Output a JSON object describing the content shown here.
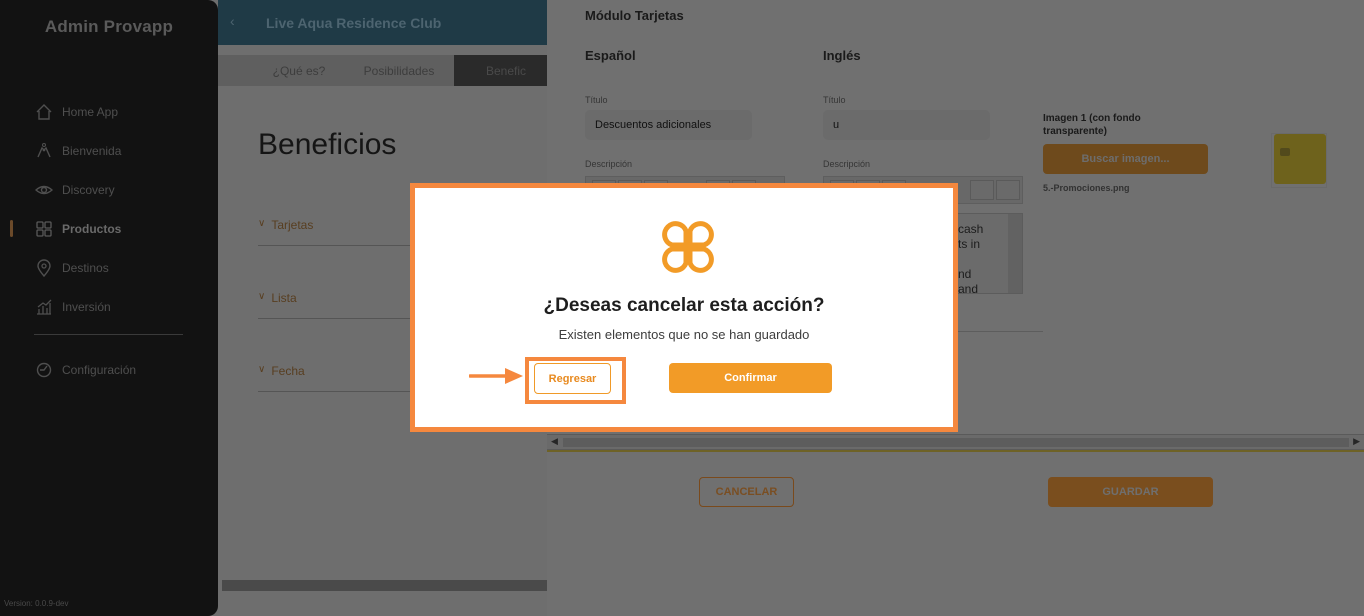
{
  "sidebar": {
    "brand": "Admin Provapp",
    "items": [
      {
        "label": "Home App",
        "icon": "home-icon"
      },
      {
        "label": "Bienvenida",
        "icon": "hands-icon"
      },
      {
        "label": "Discovery",
        "icon": "eye-icon"
      },
      {
        "label": "Productos",
        "icon": "grid-icon",
        "active": true
      },
      {
        "label": "Destinos",
        "icon": "pin-icon"
      },
      {
        "label": "Inversión",
        "icon": "chart-icon"
      }
    ],
    "config": {
      "label": "Configuración",
      "icon": "gear-icon"
    },
    "version": "Version: 0.0.9-dev"
  },
  "page": {
    "topbar_title": "Live Aqua Residence Club",
    "tabs": [
      "¿Qué es?",
      "Posibilidades",
      "Benefic"
    ],
    "title": "Beneficios",
    "accordions": [
      "Tarjetas",
      "Lista",
      "Fecha"
    ]
  },
  "drawer": {
    "title": "Módulo Tarjetas",
    "col_es": "Español",
    "col_en": "Inglés",
    "titulo_label": "Título",
    "descripcion_label": "Descripción",
    "es_title_value": "Descuentos adicionales",
    "en_title_value": "u",
    "en_desc_lines": [
      "cash",
      "ts in",
      "",
      "nd",
      "and"
    ],
    "image_label": "Imagen 1 (con fondo transparente)",
    "buscar_label": "Buscar imagen...",
    "image_file": "5.-Promociones.png",
    "cancel_label": "CANCELAR",
    "save_label": "GUARDAR"
  },
  "modal": {
    "title": "¿Deseas cancelar esta acción?",
    "subtitle": "Existen elementos que no se han guardado",
    "back_label": "Regresar",
    "confirm_label": "Confirmar",
    "accent_color": "#f29b27",
    "highlight_color": "#f5883e"
  }
}
